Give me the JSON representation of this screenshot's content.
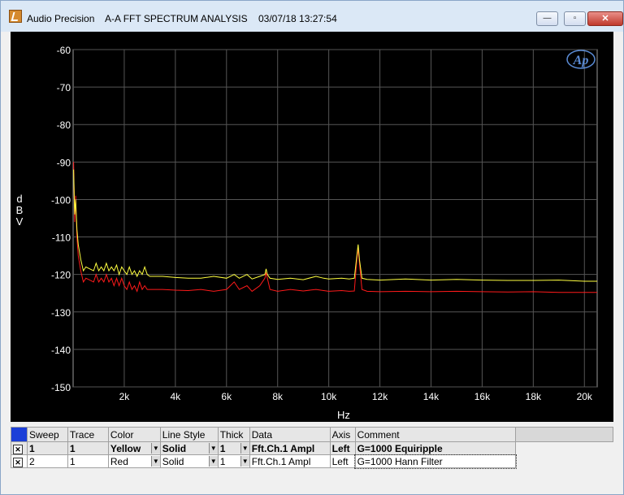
{
  "window": {
    "title": "Audio Precision    A-A FFT SPECTRUM ANALYSIS    03/07/18 13:27:54",
    "minimize_label": "—",
    "restore_label": "▫",
    "close_label": "✕",
    "logo_text": "Ap"
  },
  "chart_data": {
    "type": "line",
    "xlabel": "Hz",
    "ylabel": "dBV",
    "xlim": [
      0,
      20500
    ],
    "ylim": [
      -150,
      -60
    ],
    "x_ticks": [
      {
        "value": 2000,
        "label": "2k"
      },
      {
        "value": 4000,
        "label": "4k"
      },
      {
        "value": 6000,
        "label": "6k"
      },
      {
        "value": 8000,
        "label": "8k"
      },
      {
        "value": 10000,
        "label": "10k"
      },
      {
        "value": 12000,
        "label": "12k"
      },
      {
        "value": 14000,
        "label": "14k"
      },
      {
        "value": 16000,
        "label": "16k"
      },
      {
        "value": 18000,
        "label": "18k"
      },
      {
        "value": 20000,
        "label": "20k"
      }
    ],
    "y_ticks": [
      -60,
      -70,
      -80,
      -90,
      -100,
      -110,
      -120,
      -130,
      -140,
      -150
    ],
    "grid": true,
    "background": "#000000",
    "grid_color": "#555555",
    "series": [
      {
        "name": "Fft.Ch.1 Ampl",
        "color": "#ffff40",
        "x": [
          20,
          60,
          100,
          150,
          200,
          300,
          400,
          500,
          650,
          800,
          900,
          1000,
          1100,
          1200,
          1300,
          1400,
          1500,
          1600,
          1700,
          1800,
          1900,
          2000,
          2100,
          2200,
          2300,
          2400,
          2500,
          2600,
          2700,
          2800,
          2900,
          3000,
          3500,
          4000,
          4500,
          5000,
          5500,
          6000,
          6300,
          6500,
          6800,
          7000,
          7300,
          7500,
          7550,
          7600,
          7700,
          8000,
          8500,
          9000,
          9500,
          9800,
          10000,
          10500,
          10800,
          11000,
          11100,
          11150,
          11200,
          11300,
          11500,
          12000,
          13000,
          14000,
          15000,
          16000,
          17000,
          18000,
          19000,
          20000,
          20500
        ],
        "y": [
          -92,
          -104,
          -100,
          -108,
          -112,
          -116,
          -119,
          -118,
          -118.5,
          -119,
          -117,
          -119,
          -118,
          -119,
          -117,
          -119,
          -118,
          -119,
          -117.5,
          -120,
          -118,
          -119,
          -120,
          -118,
          -120,
          -119,
          -120.5,
          -119,
          -120,
          -118,
          -120,
          -120.5,
          -120.5,
          -120.8,
          -121,
          -121,
          -120.5,
          -121,
          -120,
          -121,
          -120,
          -121.2,
          -120.5,
          -120,
          -118.5,
          -120,
          -121,
          -121.3,
          -121,
          -121.4,
          -120.5,
          -121,
          -121.2,
          -121,
          -121.2,
          -121,
          -115,
          -112,
          -116,
          -121,
          -121.3,
          -121.5,
          -121.2,
          -121.5,
          -121.3,
          -121.5,
          -121.6,
          -121.6,
          -121.5,
          -121.8,
          -121.8
        ]
      },
      {
        "name": "Fft.Ch.1 Ampl",
        "color": "#ff1a1a",
        "x": [
          20,
          60,
          100,
          150,
          200,
          300,
          400,
          500,
          650,
          800,
          900,
          1000,
          1100,
          1200,
          1300,
          1400,
          1500,
          1600,
          1700,
          1800,
          1900,
          2000,
          2100,
          2200,
          2300,
          2400,
          2500,
          2600,
          2700,
          2800,
          2900,
          3000,
          3500,
          4000,
          4500,
          5000,
          5500,
          6000,
          6300,
          6500,
          6800,
          7000,
          7300,
          7500,
          7550,
          7600,
          7700,
          8000,
          8500,
          9000,
          9500,
          9800,
          10000,
          10500,
          10800,
          11000,
          11100,
          11150,
          11200,
          11300,
          11500,
          12000,
          13000,
          14000,
          15000,
          16000,
          17000,
          18000,
          19000,
          20000,
          20500
        ],
        "y": [
          -90,
          -106,
          -99,
          -110,
          -115,
          -119,
          -122,
          -121,
          -121.5,
          -122,
          -120,
          -122,
          -121,
          -122,
          -120,
          -122,
          -121,
          -123,
          -121,
          -123,
          -121,
          -123,
          -124,
          -122,
          -124,
          -123,
          -124.5,
          -122,
          -124,
          -123,
          -124,
          -124,
          -124,
          -124.2,
          -124.3,
          -124,
          -124.5,
          -124,
          -122,
          -124,
          -123,
          -124.5,
          -123,
          -121,
          -119.5,
          -121,
          -124,
          -124.5,
          -124,
          -124.4,
          -124,
          -124.3,
          -124.5,
          -124.3,
          -124.5,
          -124.4,
          -116,
          -113,
          -117,
          -124,
          -124.5,
          -124.6,
          -124.5,
          -124.6,
          -124.5,
          -124.6,
          -124.7,
          -124.6,
          -124.8,
          -124.8,
          -124.8
        ]
      }
    ]
  },
  "sweep_table": {
    "headers": {
      "sweep": "Sweep",
      "trace": "Trace",
      "color": "Color",
      "line_style": "Line Style",
      "thick": "Thick",
      "data": "Data",
      "axis": "Axis",
      "comment": "Comment"
    },
    "rows": [
      {
        "sweep": "1",
        "trace": "1",
        "color": "Yellow",
        "line_style": "Solid",
        "thick": "1",
        "data": "Fft.Ch.1 Ampl",
        "axis": "Left",
        "comment": "G=1000 Equiripple"
      },
      {
        "sweep": "2",
        "trace": "1",
        "color": "Red",
        "line_style": "Solid",
        "thick": "1",
        "data": "Fft.Ch.1 Ampl",
        "axis": "Left",
        "comment": "G=1000 Hann Filter"
      }
    ]
  }
}
